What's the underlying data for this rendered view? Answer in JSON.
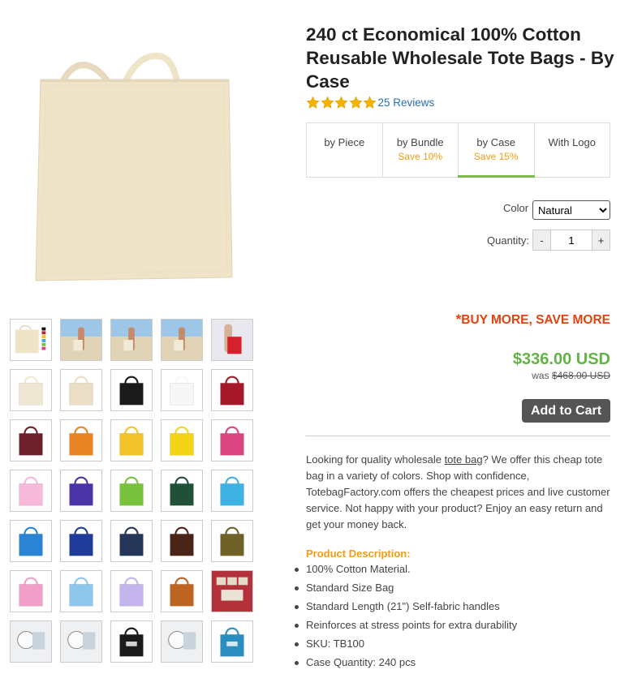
{
  "product": {
    "title": "240 ct Economical 100% Cotton Reusable Wholesale Tote Bags - By Case",
    "rating_stars": 5,
    "reviews_label": "25 Reviews",
    "image_icon": "tote-bag-image"
  },
  "tabs": [
    {
      "label": "by Piece",
      "save": ""
    },
    {
      "label": "by Bundle",
      "save": "Save 10%"
    },
    {
      "label": "by Case",
      "save": "Save 15%"
    },
    {
      "label": "With Logo",
      "save": ""
    }
  ],
  "active_tab": "by Case",
  "options": {
    "color_label": "Color",
    "color_value": "Natural",
    "quantity_label": "Quantity:",
    "quantity_value": "1",
    "minus": "-",
    "plus": "+"
  },
  "pricing": {
    "asterisk": "*",
    "buy_more": "BUY MORE, SAVE MORE",
    "price": "$336.00 USD",
    "was_label": "was",
    "was_price": "$468.00 USD",
    "add_to_cart": "Add to Cart"
  },
  "description": {
    "pre": "Looking for quality wholesale ",
    "link": "tote bag",
    "post": "? We offer this cheap tote bag in a variety of colors. Shop with confidence, TotebagFactory.com offers the cheapest prices and live customer service. Not happy with your product? Enjoy an easy return and get your money back."
  },
  "product_description": {
    "title": "Product Description:",
    "features": [
      "100% Cotton Material.",
      "Standard Size Bag",
      "Standard Length (21\") Self-fabric handles",
      "Reinforces at stress points for extra durability",
      "SKU: TB100",
      "Case Quantity: 240 pcs"
    ]
  },
  "colors": {
    "accent_green": "#7cb84a",
    "price_green": "#63b247",
    "save_orange": "#f39c12",
    "buy_more_red": "#e2420f",
    "link_blue": "#2a6fb5",
    "star_gold": "#f5b301",
    "cart_button": "#555555",
    "bag_natural": "#efe3c8"
  },
  "thumbnails": [
    {
      "kind": "swatch"
    },
    {
      "kind": "beach"
    },
    {
      "kind": "beach"
    },
    {
      "kind": "beach"
    },
    {
      "kind": "beach-red"
    },
    {
      "kind": "bag",
      "color": "#efe6d4"
    },
    {
      "kind": "bag",
      "color": "#eadfc6"
    },
    {
      "kind": "bag",
      "color": "#1a1a1a"
    },
    {
      "kind": "bag",
      "color": "#f7f7fa"
    },
    {
      "kind": "bag",
      "color": "#a5182a"
    },
    {
      "kind": "bag",
      "color": "#6e1f2c"
    },
    {
      "kind": "bag",
      "color": "#e98424"
    },
    {
      "kind": "bag",
      "color": "#f2c32a"
    },
    {
      "kind": "bag",
      "color": "#f3d418"
    },
    {
      "kind": "bag",
      "color": "#d9467f"
    },
    {
      "kind": "bag",
      "color": "#f6b9da"
    },
    {
      "kind": "bag",
      "color": "#4a34a8"
    },
    {
      "kind": "bag",
      "color": "#79c23d"
    },
    {
      "kind": "bag",
      "color": "#1f5138"
    },
    {
      "kind": "bag",
      "color": "#3fb2e4"
    },
    {
      "kind": "bag",
      "color": "#2b84d3"
    },
    {
      "kind": "bag",
      "color": "#1f3c9a"
    },
    {
      "kind": "bag",
      "color": "#253658"
    },
    {
      "kind": "bag",
      "color": "#4b2418"
    },
    {
      "kind": "bag",
      "color": "#6f6227"
    },
    {
      "kind": "bag",
      "color": "#f0a0c8"
    },
    {
      "kind": "bag",
      "color": "#8ec7ec"
    },
    {
      "kind": "bag",
      "color": "#c3b4eb"
    },
    {
      "kind": "bag",
      "color": "#bd6423"
    },
    {
      "kind": "photo-red"
    },
    {
      "kind": "photo-gray"
    },
    {
      "kind": "photo-gray"
    },
    {
      "kind": "bag-print",
      "color": "#1a1a1a"
    },
    {
      "kind": "photo-gray"
    },
    {
      "kind": "bag-print",
      "color": "#2a8fc0"
    }
  ]
}
